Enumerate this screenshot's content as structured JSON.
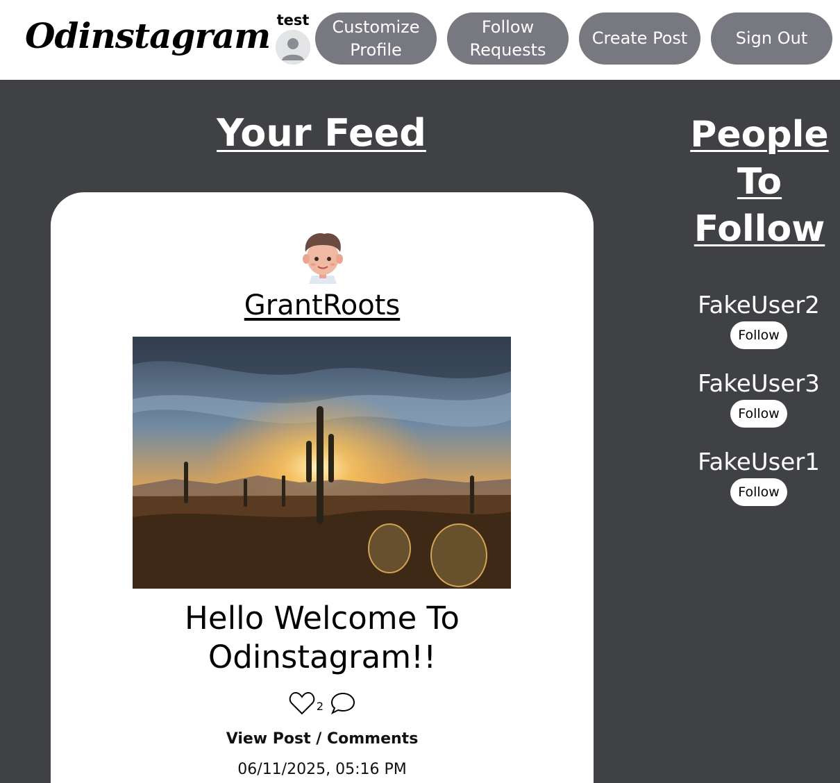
{
  "header": {
    "logo": "Odinstagram",
    "username": "test",
    "nav": {
      "customize_profile": "Customize Profile",
      "follow_requests": "Follow Requests",
      "create_post": "Create Post",
      "sign_out": "Sign Out"
    }
  },
  "feed": {
    "title": "Your Feed",
    "posts": [
      {
        "author": "GrantRoots",
        "caption": "Hello Welcome To Odinstagram!!",
        "likes": "2",
        "view_link": "View Post / Comments",
        "date": "06/11/2025, 05:16 PM"
      }
    ]
  },
  "sidebar": {
    "title": "People To Follow",
    "suggestions": [
      {
        "name": "FakeUser2",
        "button": "Follow"
      },
      {
        "name": "FakeUser3",
        "button": "Follow"
      },
      {
        "name": "FakeUser1",
        "button": "Follow"
      }
    ]
  },
  "icons": [
    "default-avatar-icon",
    "heart-icon",
    "comment-icon"
  ],
  "colors": {
    "background": "#404145",
    "header": "#ffffff",
    "nav_button": "#777880",
    "card": "#ffffff"
  }
}
